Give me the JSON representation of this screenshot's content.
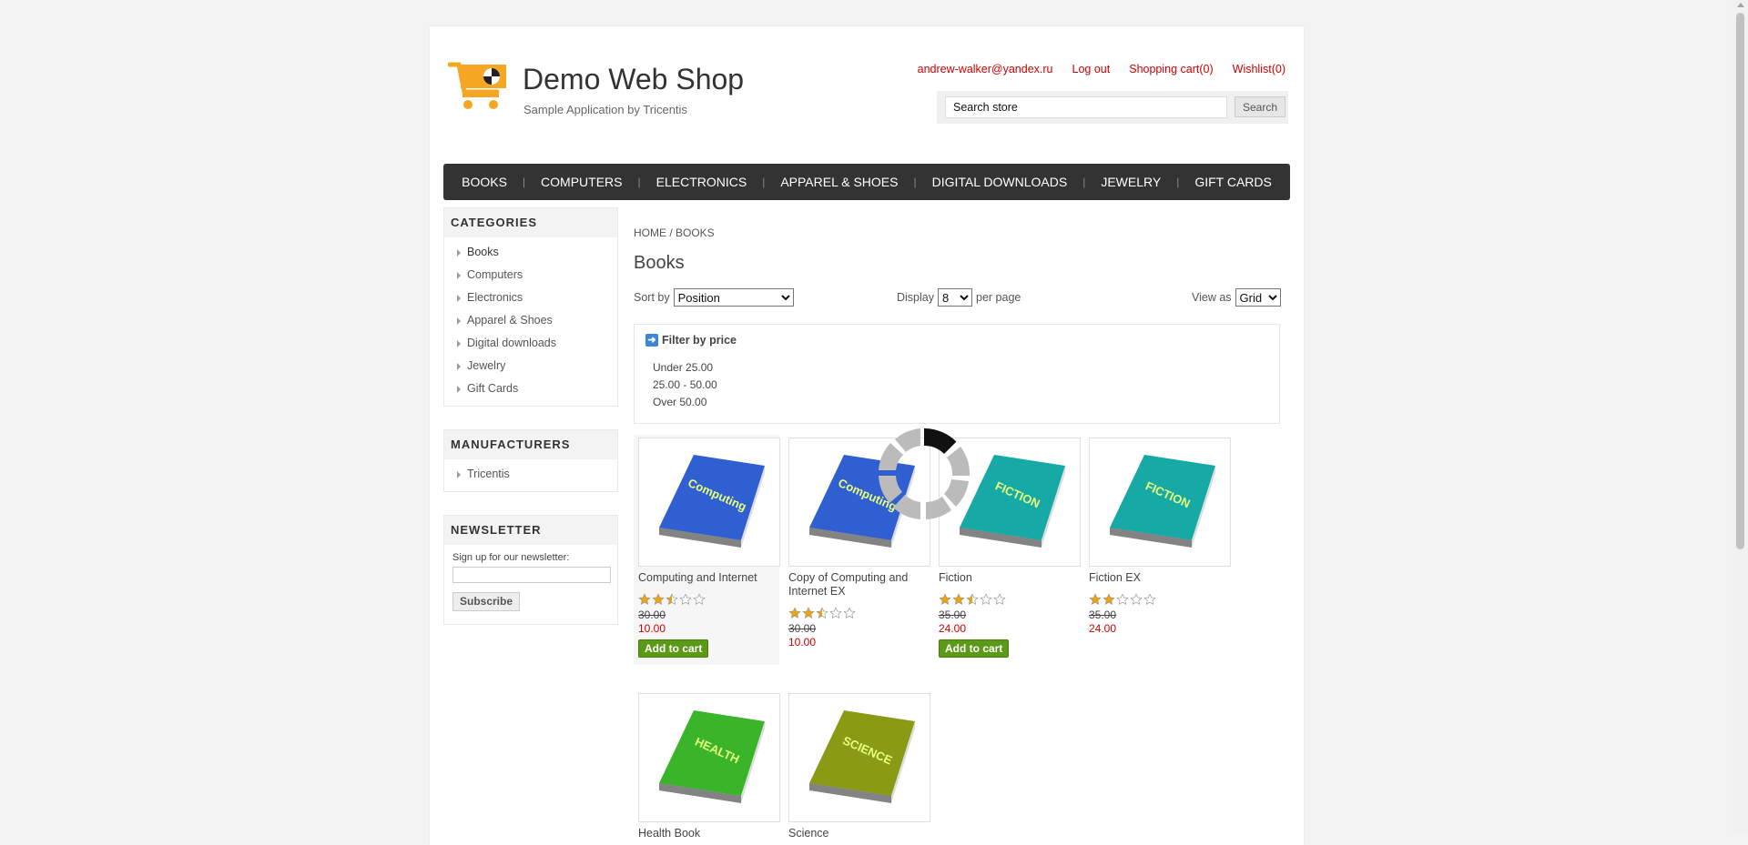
{
  "header": {
    "title": "Demo Web Shop",
    "subtitle": "Sample Application by Tricentis",
    "links": {
      "account": "andrew-walker@yandex.ru",
      "logout": "Log out",
      "cart": "Shopping cart(0)",
      "wishlist": "Wishlist(0)"
    },
    "search": {
      "value": "Search store",
      "button": "Search"
    }
  },
  "topmenu": [
    "BOOKS",
    "COMPUTERS",
    "ELECTRONICS",
    "APPAREL & SHOES",
    "DIGITAL DOWNLOADS",
    "JEWELRY",
    "GIFT CARDS"
  ],
  "sidebar": {
    "categories": {
      "title": "CATEGORIES",
      "items": [
        "Books",
        "Computers",
        "Electronics",
        "Apparel & Shoes",
        "Digital downloads",
        "Jewelry",
        "Gift Cards"
      ]
    },
    "manufacturers": {
      "title": "MANUFACTURERS",
      "items": [
        "Tricentis"
      ]
    },
    "newsletter": {
      "title": "NEWSLETTER",
      "label": "Sign up for our newsletter:",
      "button": "Subscribe"
    }
  },
  "main": {
    "breadcrumb": "HOME / BOOKS",
    "title": "Books",
    "sort": {
      "label": "Sort by",
      "value": "Position"
    },
    "display": {
      "label": "Display",
      "value": "8",
      "suffix": "per page"
    },
    "view": {
      "label": "View as",
      "value": "Grid"
    },
    "filter": {
      "title": "Filter by price",
      "ranges": [
        "Under 25.00",
        "25.00 - 50.00",
        "Over 50.00"
      ]
    }
  },
  "products": [
    {
      "name": "Computing and Internet",
      "rating": 2.5,
      "old_price": "30.00",
      "price": "10.00",
      "button": "Add to cart",
      "cover_color": "#2f5fd0",
      "cover_text": "Computing And Internet"
    },
    {
      "name": "Copy of Computing and Internet EX",
      "rating": 2.5,
      "old_price": "30.00",
      "price": "10.00",
      "button": "",
      "cover_color": "#2f5fd0",
      "cover_text": "Computing And Internet"
    },
    {
      "name": "Fiction",
      "rating": 2.5,
      "old_price": "35.00",
      "price": "24.00",
      "button": "Add to cart",
      "cover_color": "#17a9a5",
      "cover_text": "FICTION"
    },
    {
      "name": "Fiction EX",
      "rating": 2,
      "old_price": "35.00",
      "price": "24.00",
      "button": "",
      "cover_color": "#17a9a5",
      "cover_text": "FICTION"
    },
    {
      "name": "Health Book",
      "rating": 0,
      "old_price": "",
      "price": "",
      "button": "",
      "cover_color": "#3ab52a",
      "cover_text": "HEALTH"
    },
    {
      "name": "Science",
      "rating": 0,
      "old_price": "",
      "price": "",
      "button": "",
      "cover_color": "#8a9a15",
      "cover_text": "SCIENCE"
    }
  ],
  "colors": {
    "accent_link": "#cc0000",
    "menu_bg": "#333333",
    "cart_icon": "#f5a623",
    "button_green": "#5b9a17"
  },
  "icons": [
    "cart-logo-icon",
    "arrow-right-icon",
    "star-icon",
    "loading-spinner-icon"
  ]
}
